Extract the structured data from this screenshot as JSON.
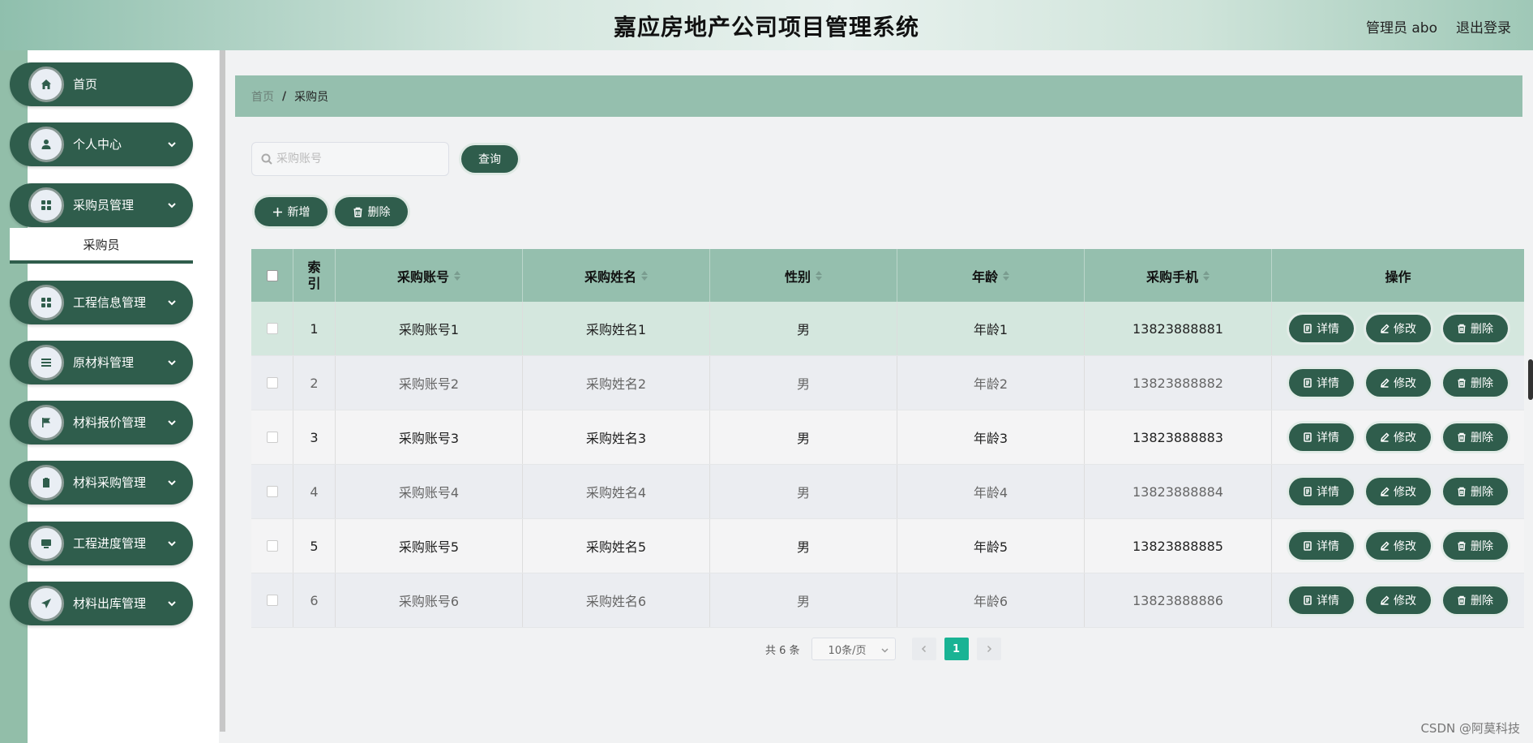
{
  "header": {
    "title": "嘉应房地产公司项目管理系统",
    "user": "管理员 abo",
    "logout": "退出登录"
  },
  "sidebar": {
    "items": [
      {
        "label": "首页",
        "icon": "home-icon"
      },
      {
        "label": "个人中心",
        "icon": "user-icon"
      },
      {
        "label": "采购员管理",
        "icon": "grid-icon"
      },
      {
        "label": "工程信息管理",
        "icon": "grid-icon"
      },
      {
        "label": "原材料管理",
        "icon": "list-icon"
      },
      {
        "label": "材料报价管理",
        "icon": "flag-icon"
      },
      {
        "label": "材料采购管理",
        "icon": "clipboard-icon"
      },
      {
        "label": "工程进度管理",
        "icon": "monitor-icon"
      },
      {
        "label": "材料出库管理",
        "icon": "send-icon"
      }
    ],
    "submenu_label": "采购员"
  },
  "breadcrumb": {
    "home": "首页",
    "separator": "/",
    "current": "采购员"
  },
  "search": {
    "placeholder": "采购账号",
    "value": "",
    "query_label": "查询"
  },
  "toolbar": {
    "add_label": "新增",
    "delete_label": "删除"
  },
  "table": {
    "headers": [
      "索引",
      "采购账号",
      "采购姓名",
      "性别",
      "年龄",
      "采购手机",
      "操作"
    ],
    "rows": [
      {
        "index": "1",
        "account": "采购账号1",
        "name": "采购姓名1",
        "gender": "男",
        "age": "年龄1",
        "phone": "13823888881"
      },
      {
        "index": "2",
        "account": "采购账号2",
        "name": "采购姓名2",
        "gender": "男",
        "age": "年龄2",
        "phone": "13823888882"
      },
      {
        "index": "3",
        "account": "采购账号3",
        "name": "采购姓名3",
        "gender": "男",
        "age": "年龄3",
        "phone": "13823888883"
      },
      {
        "index": "4",
        "account": "采购账号4",
        "name": "采购姓名4",
        "gender": "男",
        "age": "年龄4",
        "phone": "13823888884"
      },
      {
        "index": "5",
        "account": "采购账号5",
        "name": "采购姓名5",
        "gender": "男",
        "age": "年龄5",
        "phone": "13823888885"
      },
      {
        "index": "6",
        "account": "采购账号6",
        "name": "采购姓名6",
        "gender": "男",
        "age": "年龄6",
        "phone": "13823888886"
      }
    ],
    "actions": {
      "detail": "详情",
      "edit": "修改",
      "delete": "删除"
    }
  },
  "pagination": {
    "total": "共 6 条",
    "page_size": "10条/页",
    "current_page": "1"
  },
  "watermark": "CSDN @阿莫科技",
  "colors": {
    "primary": "#2f5d4c",
    "header_bg": "#95bfae",
    "page_active": "#19b394"
  }
}
